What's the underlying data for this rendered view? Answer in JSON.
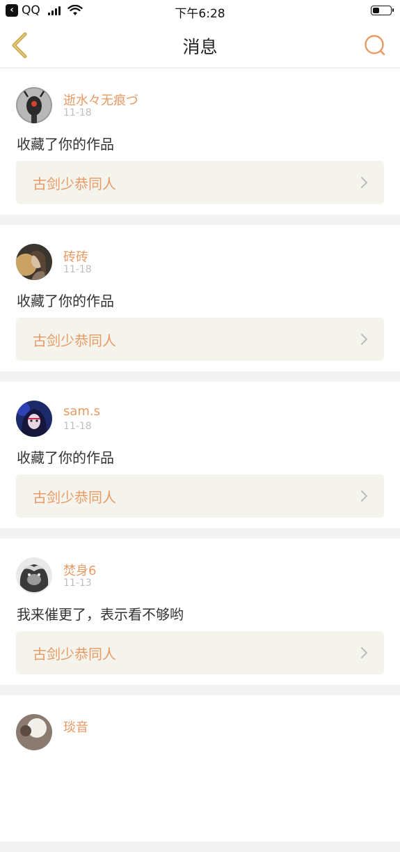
{
  "status_bar": {
    "back_app": "QQ",
    "time": "下午6:28",
    "battery_level": 0.4
  },
  "nav": {
    "title": "消息"
  },
  "colors": {
    "accent": "#e89a64",
    "back_icon": "#c9a84a",
    "card_link_bg": "#f4f4ec"
  },
  "messages": [
    {
      "username": "逝水々无痕づ",
      "date": "11-18",
      "text": "收藏了你的作品",
      "work": "古剑少恭同人",
      "avatar_icon": "robot-avatar"
    },
    {
      "username": "砖砖",
      "date": "11-18",
      "text": "收藏了你的作品",
      "work": "古剑少恭同人",
      "avatar_icon": "photo-avatar"
    },
    {
      "username": "sam.s",
      "date": "11-18",
      "text": "收藏了你的作品",
      "work": "古剑少恭同人",
      "avatar_icon": "anime-avatar"
    },
    {
      "username": "焚身6",
      "date": "11-13",
      "text": "我来催更了，表示看不够哟",
      "work": "古剑少恭同人",
      "avatar_icon": "beast-avatar"
    },
    {
      "username": "琰音",
      "avatar_icon": "photo-avatar"
    }
  ]
}
